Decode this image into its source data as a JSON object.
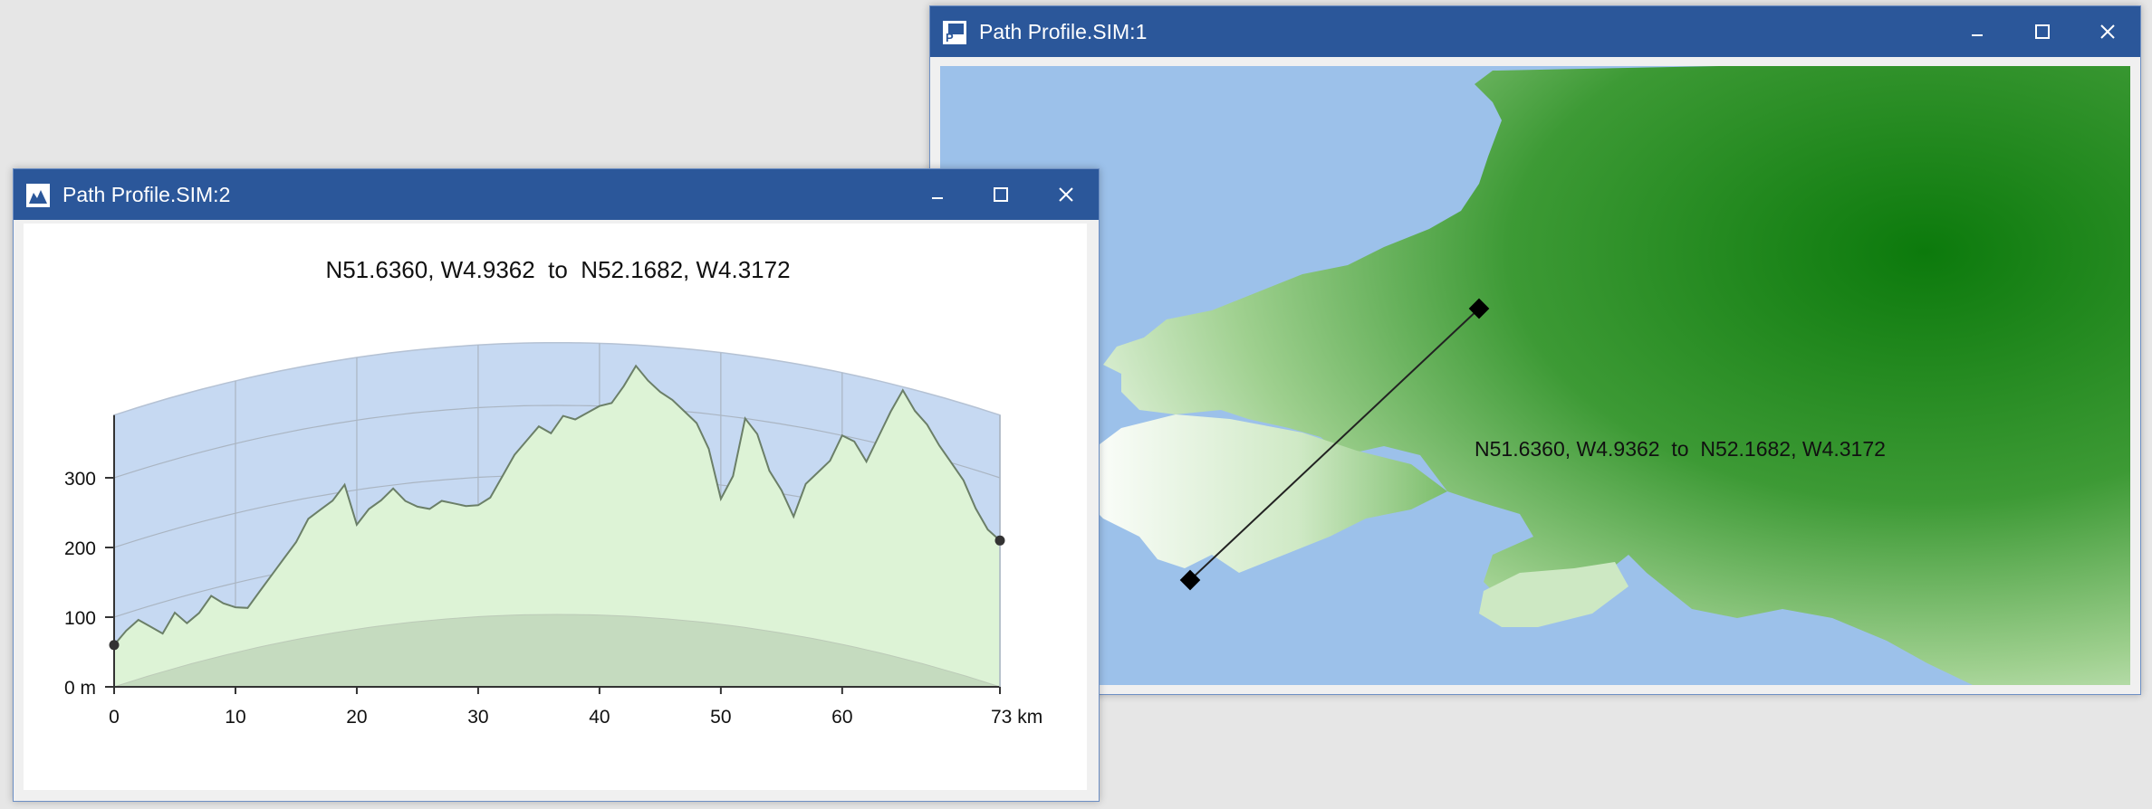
{
  "windows": {
    "map": {
      "title": "Path Profile.SIM:1"
    },
    "profile": {
      "title": "Path Profile.SIM:2"
    }
  },
  "controls": {
    "minimize": "minimize-icon",
    "maximize": "maximize-icon",
    "close": "close-icon"
  },
  "path": {
    "start": "N51.6360, W4.9362",
    "connector": "to",
    "end": "N52.1682, W4.3172"
  },
  "colors": {
    "titlebar": "#2b579a",
    "sea": "#9cc1ea",
    "land_low": "#ffffff",
    "land_high": "#0d7a0d",
    "profile_sky": "#c6d9f2",
    "profile_terrain": "#ddf3d6",
    "profile_earth_bulge": "#c5dbbf",
    "terrain_line": "#6b7f68"
  },
  "chart_data": {
    "type": "area",
    "title": "N51.6360, W4.9362  to  N52.1682, W4.3172",
    "xlabel": "",
    "ylabel": "",
    "x_ticks": [
      "0",
      "10",
      "20",
      "30",
      "40",
      "50",
      "60",
      "73 km"
    ],
    "y_ticks": [
      "0 m",
      "100",
      "200",
      "300"
    ],
    "xlim": [
      0,
      73
    ],
    "ylim": [
      0,
      390
    ],
    "grid": true,
    "series": [
      {
        "x": [
          0,
          1,
          2,
          3,
          4,
          5,
          6,
          7,
          8,
          9,
          10,
          11,
          12,
          13,
          14,
          15,
          16,
          17,
          18,
          19,
          20,
          21,
          22,
          23,
          24,
          25,
          26,
          27,
          28,
          29,
          30,
          31,
          32,
          33,
          34,
          35,
          36,
          37,
          38,
          39,
          40,
          41,
          42,
          43,
          44,
          45,
          46,
          47,
          48,
          49,
          50,
          51,
          52,
          53,
          54,
          55,
          56,
          57,
          58,
          59,
          60,
          61,
          62,
          63,
          64,
          65,
          66,
          67,
          68,
          69,
          70,
          71,
          72,
          73
        ],
        "values": [
          60,
          75,
          85,
          70,
          55,
          80,
          60,
          70,
          90,
          75,
          65,
          60,
          80,
          100,
          120,
          140,
          170,
          180,
          190,
          210,
          150,
          170,
          180,
          195,
          175,
          165,
          160,
          170,
          165,
          160,
          160,
          170,
          200,
          230,
          250,
          270,
          260,
          285,
          280,
          290,
          300,
          305,
          330,
          360,
          340,
          325,
          315,
          300,
          285,
          250,
          180,
          215,
          300,
          280,
          230,
          205,
          170,
          220,
          240,
          260,
          300,
          295,
          270,
          310,
          350,
          385,
          360,
          345,
          320,
          300,
          280,
          245,
          220,
          210
        ]
      }
    ]
  }
}
